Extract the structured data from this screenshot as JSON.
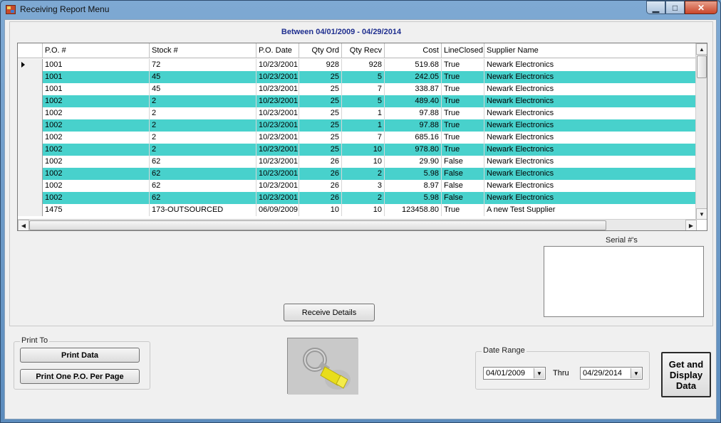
{
  "window": {
    "title": "Receiving Report Menu",
    "min": "▁",
    "max": "□",
    "close": "✕"
  },
  "header": {
    "between": "Between 04/01/2009 - 04/29/2014"
  },
  "grid": {
    "columns": [
      "P.O. #",
      "Stock #",
      "P.O. Date",
      "Qty Ord",
      "Qty Recv",
      "Cost",
      "LineClosed",
      "Supplier Name"
    ],
    "rows": [
      {
        "po": "1001",
        "stock": "72",
        "date": "10/23/2001",
        "ord": "928",
        "recv": "928",
        "cost": "519.68",
        "closed": "True",
        "supplier": "Newark Electronics"
      },
      {
        "po": "1001",
        "stock": "45",
        "date": "10/23/2001",
        "ord": "25",
        "recv": "5",
        "cost": "242.05",
        "closed": "True",
        "supplier": "Newark Electronics"
      },
      {
        "po": "1001",
        "stock": "45",
        "date": "10/23/2001",
        "ord": "25",
        "recv": "7",
        "cost": "338.87",
        "closed": "True",
        "supplier": "Newark Electronics"
      },
      {
        "po": "1002",
        "stock": "2",
        "date": "10/23/2001",
        "ord": "25",
        "recv": "5",
        "cost": "489.40",
        "closed": "True",
        "supplier": "Newark Electronics"
      },
      {
        "po": "1002",
        "stock": "2",
        "date": "10/23/2001",
        "ord": "25",
        "recv": "1",
        "cost": "97.88",
        "closed": "True",
        "supplier": "Newark Electronics"
      },
      {
        "po": "1002",
        "stock": "2",
        "date": "10/23/2001",
        "ord": "25",
        "recv": "1",
        "cost": "97.88",
        "closed": "True",
        "supplier": "Newark Electronics"
      },
      {
        "po": "1002",
        "stock": "2",
        "date": "10/23/2001",
        "ord": "25",
        "recv": "7",
        "cost": "685.16",
        "closed": "True",
        "supplier": "Newark Electronics"
      },
      {
        "po": "1002",
        "stock": "2",
        "date": "10/23/2001",
        "ord": "25",
        "recv": "10",
        "cost": "978.80",
        "closed": "True",
        "supplier": "Newark Electronics"
      },
      {
        "po": "1002",
        "stock": "62",
        "date": "10/23/2001",
        "ord": "26",
        "recv": "10",
        "cost": "29.90",
        "closed": "False",
        "supplier": "Newark Electronics"
      },
      {
        "po": "1002",
        "stock": "62",
        "date": "10/23/2001",
        "ord": "26",
        "recv": "2",
        "cost": "5.98",
        "closed": "False",
        "supplier": "Newark Electronics"
      },
      {
        "po": "1002",
        "stock": "62",
        "date": "10/23/2001",
        "ord": "26",
        "recv": "3",
        "cost": "8.97",
        "closed": "False",
        "supplier": "Newark Electronics"
      },
      {
        "po": "1002",
        "stock": "62",
        "date": "10/23/2001",
        "ord": "26",
        "recv": "2",
        "cost": "5.98",
        "closed": "False",
        "supplier": "Newark Electronics"
      },
      {
        "po": "1475",
        "stock": "173-OUTSOURCED",
        "date": "06/09/2009",
        "ord": "10",
        "recv": "10",
        "cost": "123458.80",
        "closed": "True",
        "supplier": "A new Test Supplier"
      }
    ],
    "alt_color": "#48d1cc"
  },
  "serial": {
    "label": "Serial #'s"
  },
  "buttons": {
    "receive_details": "Receive Details",
    "print_data": "Print Data",
    "print_one_po": "Print One P.O. Per Page",
    "get_display_line1": "Get and",
    "get_display_line2": "Display",
    "get_display_line3": "Data"
  },
  "print_to": {
    "legend": "Print To"
  },
  "date_range": {
    "legend": "Date Range",
    "from": "04/01/2009",
    "thru": "Thru",
    "to": "04/29/2014"
  },
  "icons": {
    "scroll_up": "▲",
    "scroll_down": "▼",
    "scroll_left": "◀",
    "scroll_right": "▶",
    "dropdown": "▼"
  }
}
